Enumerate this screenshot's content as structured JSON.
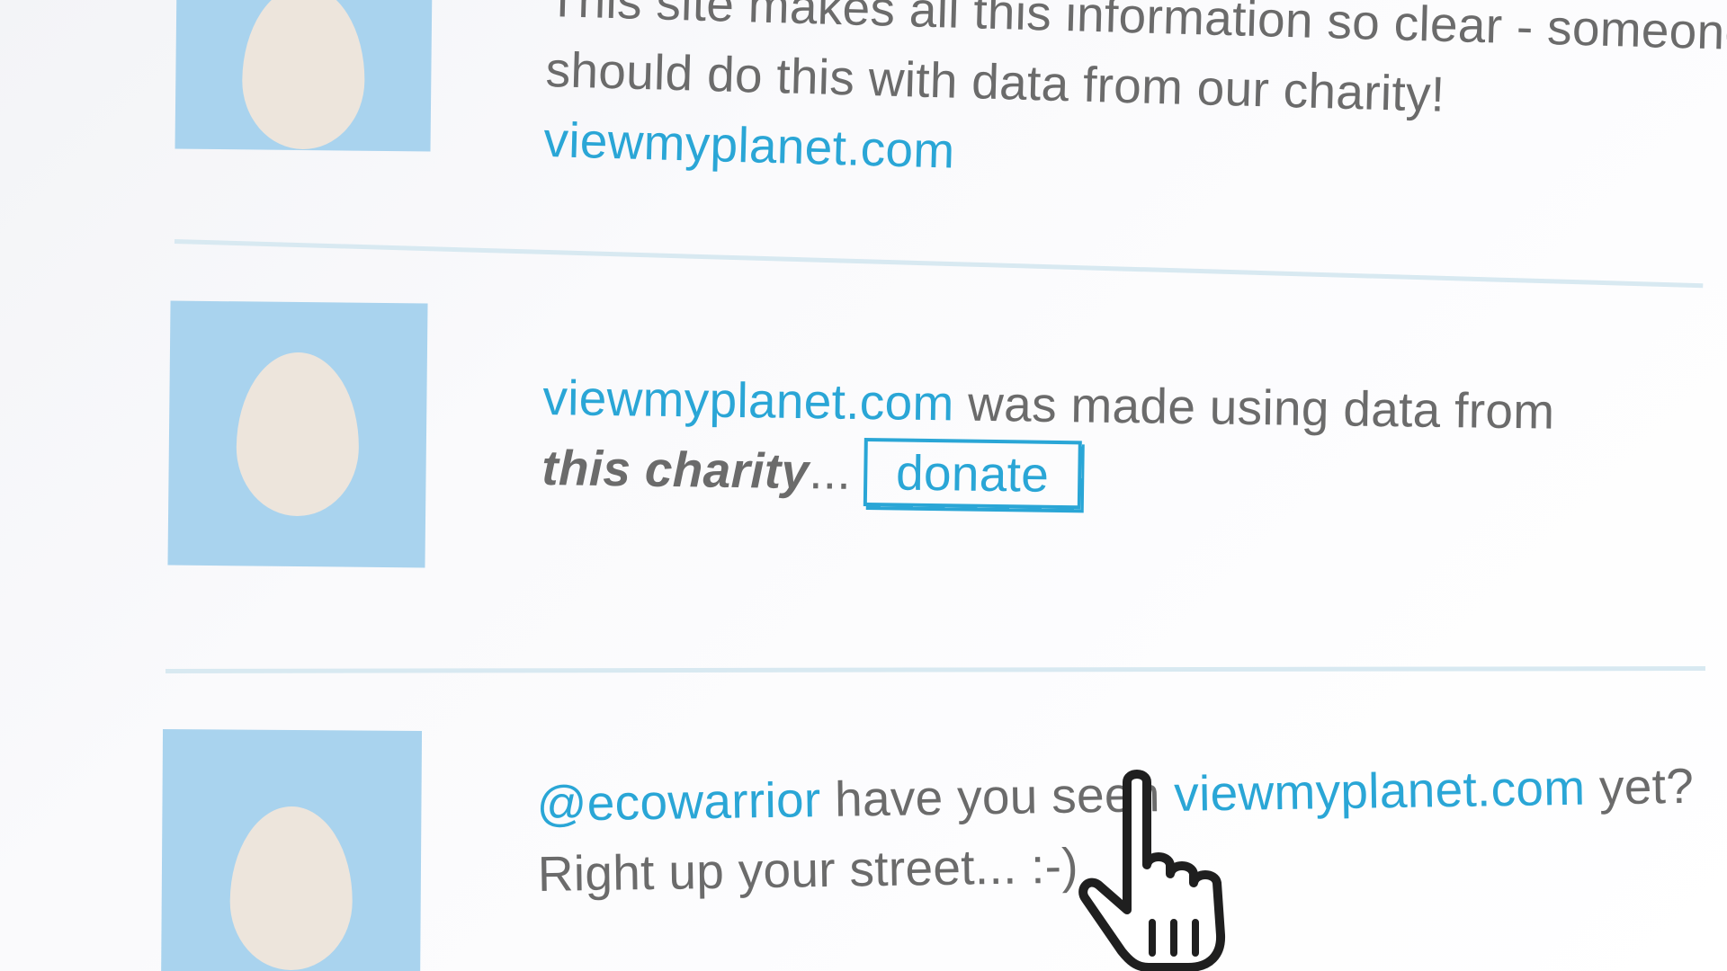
{
  "feed": {
    "tweet1": {
      "line1": "This site makes all this information so clear - someone",
      "line2": "should do this with data from our charity!",
      "link": "viewmyplanet.com"
    },
    "tweet2": {
      "link": "viewmyplanet.com",
      "text1": " was made using data from",
      "charity": "this charity",
      "ellipsis": "...",
      "donate_label": "donate"
    },
    "tweet3": {
      "mention": "@ecowarrior",
      "text1": " have you seen ",
      "link": "viewmyplanet.com",
      "text2": " yet?",
      "line2": "Right up your street... :-)"
    }
  },
  "colors": {
    "link": "#2aa6d6",
    "text": "#6b6b6b",
    "avatar_bg": "#a9d3ee",
    "egg": "#ede5dc",
    "divider": "#d8e9f1"
  },
  "icons": {
    "avatar": "egg-avatar-icon",
    "cursor": "hand-pointer-icon"
  }
}
